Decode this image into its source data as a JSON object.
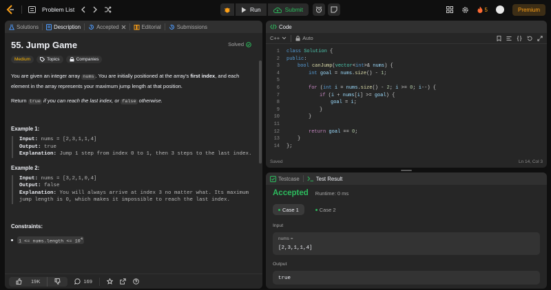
{
  "topbar": {
    "problem_list": "Problem List",
    "run_label": "Run",
    "submit_label": "Submit",
    "streak_count": "5",
    "premium_label": "Premium"
  },
  "tabs": {
    "solutions": "Solutions",
    "description": "Description",
    "accepted": "Accepted",
    "editorial": "Editorial",
    "submissions": "Submissions"
  },
  "problem": {
    "title": "55. Jump Game",
    "status": "Solved",
    "difficulty": "Medium",
    "topics": "Topics",
    "companies": "Companies",
    "p1_a": "You are given an integer array ",
    "p1_code": "nums",
    "p1_b": ". You are initially positioned at the array's ",
    "p1_bold": "first index",
    "p1_c": ", and each element in the array represents your maximum jump length at that position.",
    "p2_a": "Return ",
    "p2_true": "true",
    "p2_b": " if you can reach the last index, or ",
    "p2_false": "false",
    "p2_c": " otherwise.",
    "example1_title": "Example 1:",
    "ex1_input_label": "Input:",
    "ex1_input": " nums = [2,3,1,1,4]",
    "ex1_output_label": "Output:",
    "ex1_output": " true",
    "ex1_expl_label": "Explanation:",
    "ex1_expl": " Jump 1 step from index 0 to 1, then 3 steps to the last index.",
    "example2_title": "Example 2:",
    "ex2_input_label": "Input:",
    "ex2_input": " nums = [3,2,1,0,4]",
    "ex2_output_label": "Output:",
    "ex2_output": " false",
    "ex2_expl_label": "Explanation:",
    "ex2_expl": " You will always arrive at index 3 no matter what. Its maximum jump length is 0, which makes it impossible to reach the last index.",
    "constraints_title": "Constraints:",
    "constraint1": "1 <= nums.length <= 10",
    "constraint1_sup": "4"
  },
  "footer": {
    "likes": "19K",
    "comments": "169"
  },
  "code": {
    "panel_title": "Code",
    "language": "C++",
    "mode": "Auto",
    "status": "Saved",
    "cursor": "Ln 14, Col 3",
    "line_numbers": [
      "1",
      "2",
      "3",
      "4",
      "5",
      "6",
      "7",
      "8",
      "9",
      "10",
      "11",
      "12",
      "13",
      "14"
    ]
  },
  "result": {
    "testcase_tab": "Testcase",
    "result_tab": "Test Result",
    "verdict": "Accepted",
    "runtime": "Runtime: 0 ms",
    "case1": "Case 1",
    "case2": "Case 2",
    "input_label": "Input",
    "input_name": "nums =",
    "input_value": "[2,3,1,1,4]",
    "output_label": "Output",
    "output_value": "true"
  },
  "colors": {
    "accent_orange": "#ffa116",
    "success_green": "#2cbb5d",
    "panel_bg": "#262626",
    "page_bg": "#0f0f0f"
  }
}
